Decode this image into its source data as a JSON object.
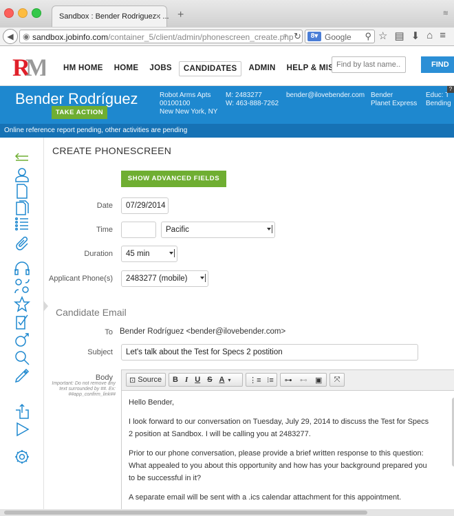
{
  "browser": {
    "tab_title": "Sandbox : Bender Rodriguez : ...",
    "tab_close": "×",
    "new_tab": "+",
    "url_domain": "sandbox.jobinfo.com",
    "url_path": "/container_5/client/admin/phonescreen_create.php",
    "search_engine": "Google",
    "tabbar_right": "≋"
  },
  "site": {
    "nav": [
      "HM HOME",
      "HOME",
      "JOBS",
      "CANDIDATES",
      "ADMIN",
      "HELP & MISC."
    ],
    "active_nav": "CANDIDATES",
    "find_placeholder": "Find by last name...",
    "find_button": "FIND",
    "brand_red": "#e0202a",
    "brand_gray": "#999999"
  },
  "candidate": {
    "name": "Bender Rodríguez",
    "take_action": "TAKE ACTION",
    "address_line1": "Robot Arms Apts",
    "address_line2": "00100100",
    "address_line3": "New New York, NY",
    "phone_m": "M: 2483277",
    "phone_w": "W: 463-888-7262",
    "email": "bender@ilovebender.com",
    "employer_line1": "Bender",
    "employer_line2": "Planet Express",
    "educ_line1": "Educ: T",
    "educ_line2": "Bending",
    "help": "?",
    "pending_message": "Online reference report pending, other activities are pending"
  },
  "sidebar_icons": [
    "collapse-arrow-icon",
    "person-icon",
    "document-icon",
    "documents-icon",
    "list-icon",
    "paperclip-icon",
    "headset-icon",
    "people-connect-icon",
    "star-icon",
    "checklist-icon",
    "assessment-icon",
    "search-icon",
    "tag-icon",
    "export-icon",
    "play-icon",
    "settings-icon"
  ],
  "form": {
    "title": "CREATE PHONESCREEN",
    "advanced_button": "SHOW ADVANCED FIELDS",
    "date_label": "Date",
    "date_value": "07/29/2014",
    "time_label": "Time",
    "time_value": "",
    "timezone_value": "Pacific",
    "duration_label": "Duration",
    "duration_value": "45 min",
    "phone_label": "Applicant Phone(s)",
    "phone_value": "2483277 (mobile)"
  },
  "email": {
    "section_title": "Candidate Email",
    "to_label": "To",
    "to_value": "Bender Rodríguez <bender@ilovebender.com>",
    "subject_label": "Subject",
    "subject_value": "Let's talk about the Test for Specs 2 postition",
    "body_label": "Body",
    "body_hint": "Important: Do not remove any text surrounded by ##. Ex: ##app_confirm_link##",
    "toolbar": {
      "source": "Source",
      "bold": "B",
      "italic": "I",
      "underline": "U",
      "strike": "S",
      "color": "A"
    },
    "body_paragraphs": [
      "Hello Bender,",
      "I look forward to our conversation on Tuesday, July 29, 2014 to discuss the Test for Specs 2 position at Sandbox. I will be calling you at 2483277.",
      "Prior to our phone conversation, please provide a brief written response to this question: What appealed to you about this opportunity and how has your background prepared you to be successful in it?",
      "A separate email will be sent with a .ics calendar attachment for this appointment."
    ]
  }
}
